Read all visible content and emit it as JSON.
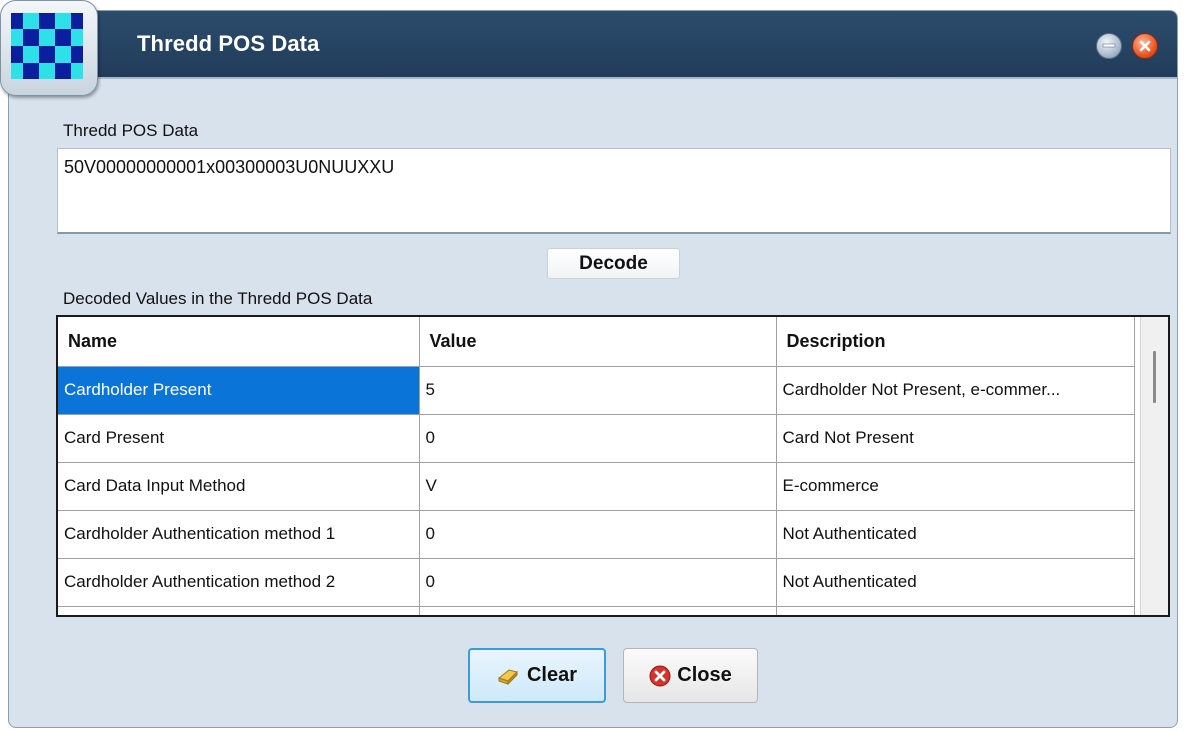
{
  "window": {
    "title": "Thredd POS Data",
    "controls": {
      "minimize_icon": "minimize-circle-icon",
      "close_icon": "close-circle-icon"
    }
  },
  "input": {
    "label": "Thredd POS Data",
    "value": "50V00000000001x00300003U0NUUXXU"
  },
  "decode_button": "Decode",
  "grid": {
    "label": "Decoded Values in the Thredd POS Data",
    "columns": [
      "Name",
      "Value",
      "Description"
    ],
    "rows": [
      {
        "name": "Cardholder Present",
        "value": "5",
        "description": "Cardholder Not Present, e-commer..."
      },
      {
        "name": "Card Present",
        "value": "0",
        "description": "Card Not Present"
      },
      {
        "name": "Card Data Input Method",
        "value": "V",
        "description": "E-commerce"
      },
      {
        "name": "Cardholder Authentication method 1",
        "value": "0",
        "description": "Not Authenticated"
      },
      {
        "name": "Cardholder Authentication method 2",
        "value": "0",
        "description": "Not Authenticated"
      },
      {
        "name": "",
        "value": "",
        "description": ""
      }
    ],
    "selected_row": 0
  },
  "buttons": {
    "clear": "Clear",
    "close": "Close"
  },
  "colors": {
    "titlebar": "#2c4c6c",
    "selection": "#0a74d8",
    "window_bg": "#d8e2ec"
  }
}
